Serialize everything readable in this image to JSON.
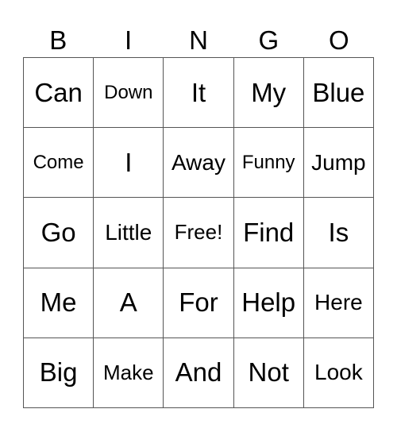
{
  "header": [
    "B",
    "I",
    "N",
    "G",
    "O"
  ],
  "cells": [
    [
      "Can",
      "Down",
      "It",
      "My",
      "Blue"
    ],
    [
      "Come",
      "I",
      "Away",
      "Funny",
      "Jump"
    ],
    [
      "Go",
      "Little",
      "Free!",
      "Find",
      "Is"
    ],
    [
      "Me",
      "A",
      "For",
      "Help",
      "Here"
    ],
    [
      "Big",
      "Make",
      "And",
      "Not",
      "Look"
    ]
  ]
}
